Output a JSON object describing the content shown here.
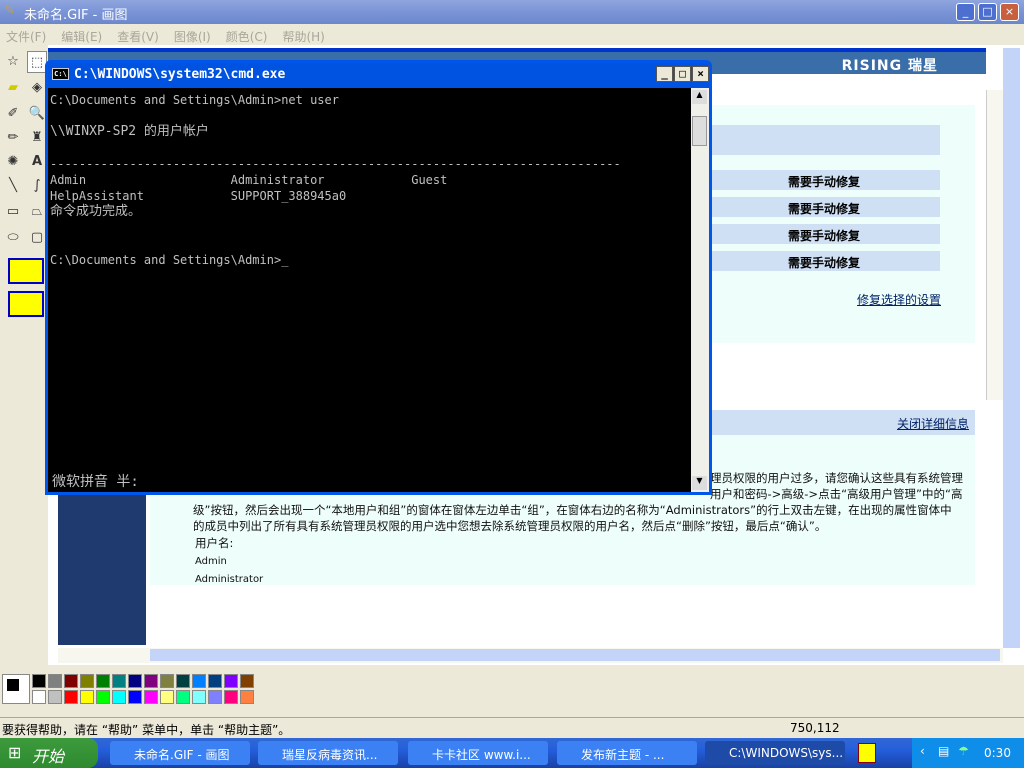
{
  "window": {
    "title": "未命名.GIF - 画图",
    "minimize": "_",
    "maximize": "□",
    "close": "×"
  },
  "menu": [
    "文件(F)",
    "编辑(E)",
    "查看(V)",
    "图像(I)",
    "颜色(C)",
    "帮助(H)"
  ],
  "webpage": {
    "logo": "RISING 瑞星",
    "status_rows": [
      "需要手动修复",
      "需要手动修复",
      "需要手动修复",
      "需要手动修复"
    ],
    "repair_link": "修复选择的设置",
    "close_details_link": "关闭详细信息",
    "detail_line1": "理员权限的用户过多，请您确认这些具有系统管理",
    "detail_line2": "用户和密码->高级->点击“高级用户管理”中的“高",
    "detail_line3": "级”按钮，然后会出现一个“本地用户和组”的窗体在窗体左边单击“组”，在窗体右边的名称为“Administrators”的行上双击左键，在出现的属性窗体中",
    "detail_line4": "的成员中列出了所有具有系统管理员权限的用户选中您想去除系统管理员权限的用户名，然后点“删除”按钮，最后点“确认”。",
    "username_label": "用户名:",
    "users": [
      "Admin",
      "Administrator"
    ]
  },
  "cmd": {
    "title": "C:\\WINDOWS\\system32\\cmd.exe",
    "lines": [
      "C:\\Documents and Settings\\Admin>net user",
      "",
      "\\\\WINXP-SP2 的用户帐户",
      "",
      "-------------------------------------------------------------------------------",
      "Admin                    Administrator            Guest",
      "HelpAssistant            SUPPORT_388945a0",
      "命令成功完成。",
      "",
      "",
      "C:\\Documents and Settings\\Admin>_"
    ],
    "ime": "微软拼音 半:"
  },
  "palette": {
    "top": [
      "#000000",
      "#808080",
      "#800000",
      "#808000",
      "#008000",
      "#008080",
      "#000080",
      "#800080",
      "#808040",
      "#004040",
      "#0080ff",
      "#004080",
      "#8000ff",
      "#804000"
    ],
    "bottom": [
      "#ffffff",
      "#c0c0c0",
      "#ff0000",
      "#ffff00",
      "#00ff00",
      "#00ffff",
      "#0000ff",
      "#ff00ff",
      "#ffff80",
      "#00ff80",
      "#80ffff",
      "#8080ff",
      "#ff0080",
      "#ff8040"
    ],
    "foreground": "#000000",
    "background": "#ffffff"
  },
  "status": {
    "help": "要获得帮助，请在 “帮助” 菜单中，单击 “帮助主题”。",
    "coords": "750,112"
  },
  "taskbar": {
    "start": "开始",
    "tasks": [
      "未命名.GIF - 画图",
      "瑞星反病毒资讯...",
      "卡卡社区 www.i...",
      "发布新主题 - ...",
      "C:\\WINDOWS\\sys..."
    ],
    "clock": "0:30"
  }
}
